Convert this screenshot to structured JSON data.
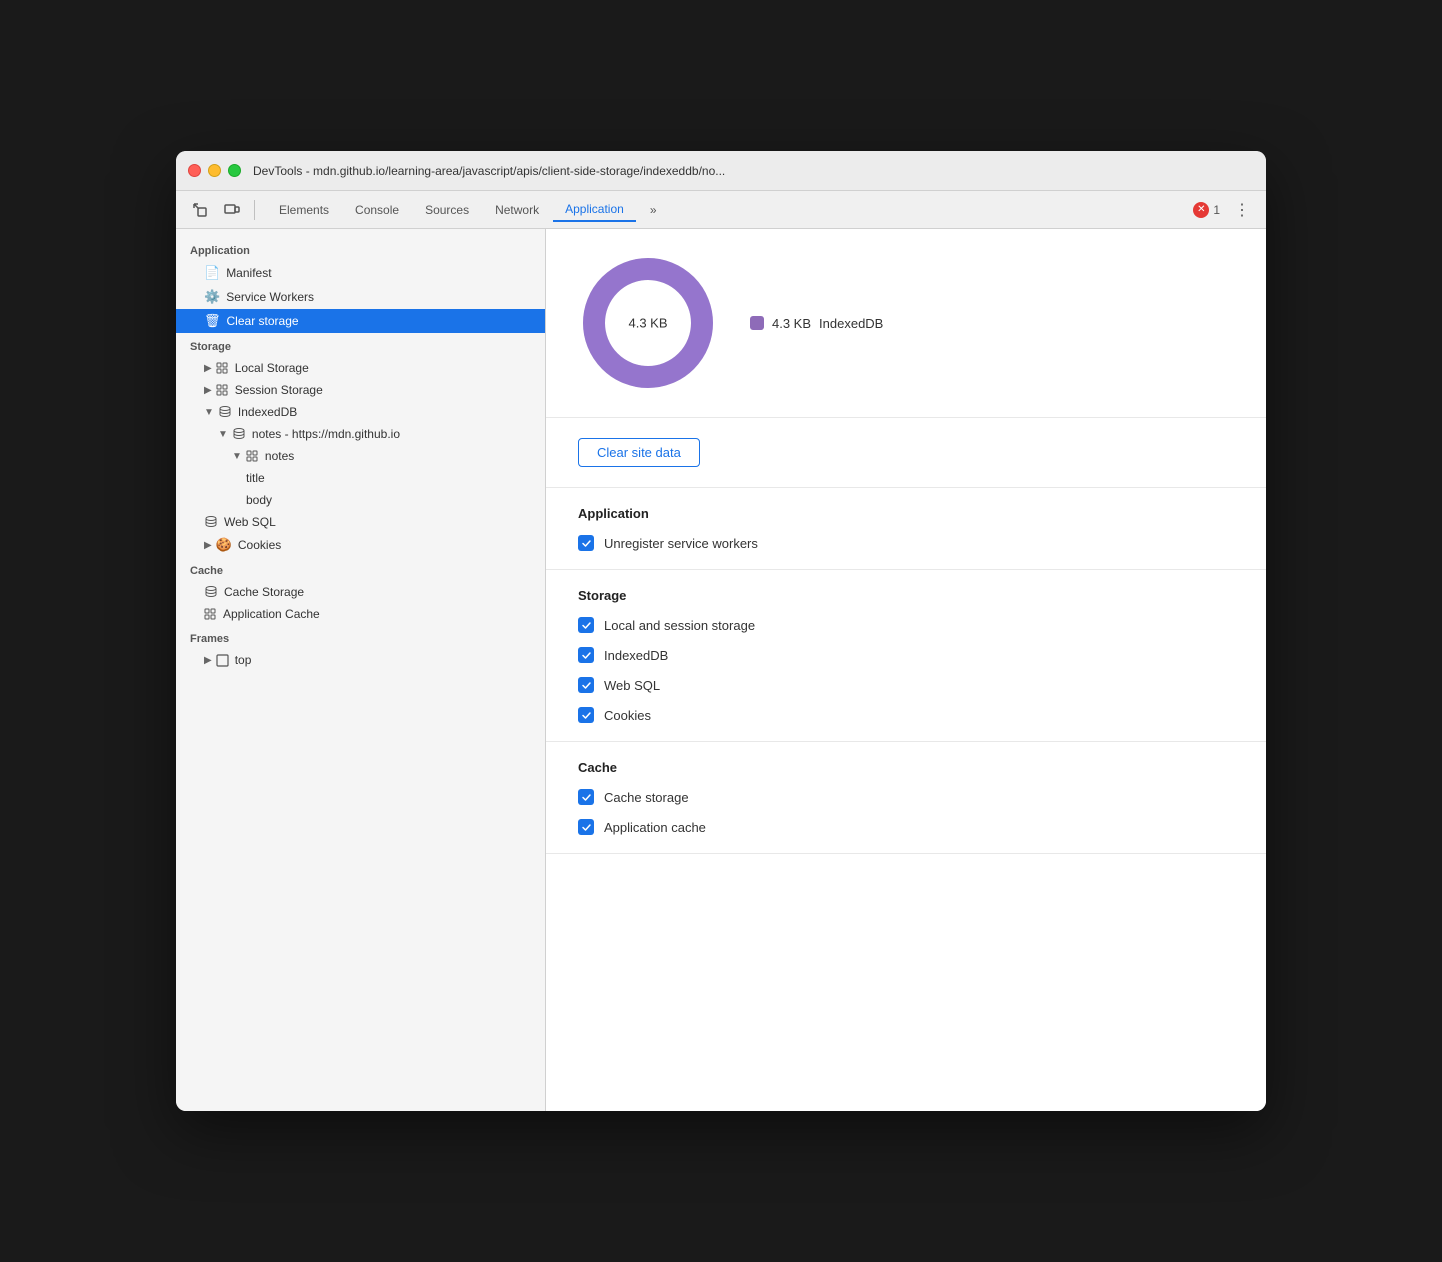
{
  "titlebar": {
    "title": "DevTools - mdn.github.io/learning-area/javascript/apis/client-side-storage/indexeddb/no..."
  },
  "toolbar": {
    "inspector_icon": "⬚",
    "device_icon": "⬜",
    "tabs": [
      "Elements",
      "Console",
      "Sources",
      "Network",
      "Application",
      "»"
    ],
    "active_tab": "Application",
    "error_count": "1",
    "more_icon": "⋮"
  },
  "sidebar": {
    "application_section": "Application",
    "application_items": [
      {
        "id": "manifest",
        "label": "Manifest",
        "icon": "doc",
        "indent": 1
      },
      {
        "id": "service-workers",
        "label": "Service Workers",
        "icon": "gear",
        "indent": 1
      },
      {
        "id": "clear-storage",
        "label": "Clear storage",
        "icon": "trash",
        "indent": 1,
        "active": true
      }
    ],
    "storage_section": "Storage",
    "storage_items": [
      {
        "id": "local-storage",
        "label": "Local Storage",
        "icon": "grid",
        "indent": 1,
        "arrow": "▶"
      },
      {
        "id": "session-storage",
        "label": "Session Storage",
        "icon": "grid",
        "indent": 1,
        "arrow": "▶"
      },
      {
        "id": "indexeddb",
        "label": "IndexedDB",
        "icon": "db",
        "indent": 1,
        "arrow": "▼"
      },
      {
        "id": "notes-db",
        "label": "notes - https://mdn.github.io",
        "icon": "db",
        "indent": 2,
        "arrow": "▼"
      },
      {
        "id": "notes-table",
        "label": "notes",
        "icon": "grid",
        "indent": 3,
        "arrow": "▼"
      },
      {
        "id": "title-field",
        "label": "title",
        "icon": "",
        "indent": 4
      },
      {
        "id": "body-field",
        "label": "body",
        "icon": "",
        "indent": 4
      },
      {
        "id": "web-sql",
        "label": "Web SQL",
        "icon": "db",
        "indent": 1
      },
      {
        "id": "cookies",
        "label": "Cookies",
        "icon": "cookie",
        "indent": 1,
        "arrow": "▶"
      }
    ],
    "cache_section": "Cache",
    "cache_items": [
      {
        "id": "cache-storage",
        "label": "Cache Storage",
        "icon": "db",
        "indent": 1
      },
      {
        "id": "app-cache",
        "label": "Application Cache",
        "icon": "grid",
        "indent": 1
      }
    ],
    "frames_section": "Frames",
    "frames_items": [
      {
        "id": "top-frame",
        "label": "top",
        "icon": "frame",
        "indent": 1,
        "arrow": "▶"
      }
    ]
  },
  "chart": {
    "center_label": "4.3 KB",
    "legend_value": "4.3 KB",
    "legend_label": "IndexedDB",
    "color": "#9575cd"
  },
  "buttons": {
    "clear_site_data": "Clear site data"
  },
  "application_section": {
    "title": "Application",
    "checkboxes": [
      {
        "id": "unregister-sw",
        "label": "Unregister service workers",
        "checked": true
      }
    ]
  },
  "storage_section": {
    "title": "Storage",
    "checkboxes": [
      {
        "id": "local-session",
        "label": "Local and session storage",
        "checked": true
      },
      {
        "id": "indexeddb-cb",
        "label": "IndexedDB",
        "checked": true
      },
      {
        "id": "web-sql-cb",
        "label": "Web SQL",
        "checked": true
      },
      {
        "id": "cookies-cb",
        "label": "Cookies",
        "checked": true
      }
    ]
  },
  "cache_section": {
    "title": "Cache",
    "checkboxes": [
      {
        "id": "cache-storage-cb",
        "label": "Cache storage",
        "checked": true
      },
      {
        "id": "app-cache-cb",
        "label": "Application cache",
        "checked": true
      }
    ]
  }
}
